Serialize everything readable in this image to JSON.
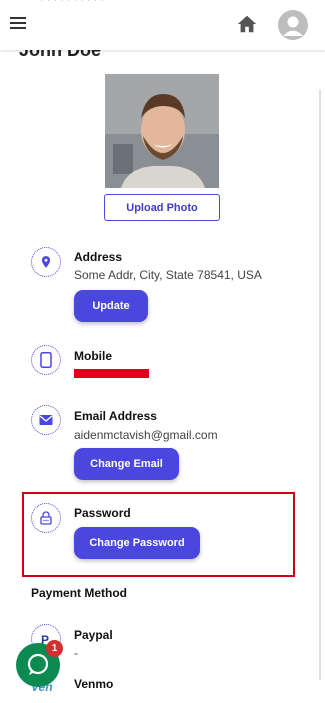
{
  "header": {
    "cut_text": "· · · · · · · · · ·"
  },
  "profile": {
    "name": "John Doe",
    "upload_label": "Upload Photo"
  },
  "address": {
    "title": "Address",
    "value": "Some Addr, City, State 78541, USA",
    "button": "Update"
  },
  "mobile": {
    "title": "Mobile"
  },
  "email": {
    "title": "Email Address",
    "value": "aidenmctavish@gmail.com",
    "button": "Change Email"
  },
  "password": {
    "title": "Password",
    "button": "Change Password"
  },
  "payment": {
    "title": "Payment Method",
    "methods": [
      {
        "name": "Paypal",
        "value": "-"
      },
      {
        "name": "Venmo",
        "value": ""
      }
    ]
  },
  "chat": {
    "badge": "1"
  },
  "colors": {
    "accent": "#4a46e0",
    "highlight": "#d10012",
    "chat": "#0c8a52"
  }
}
